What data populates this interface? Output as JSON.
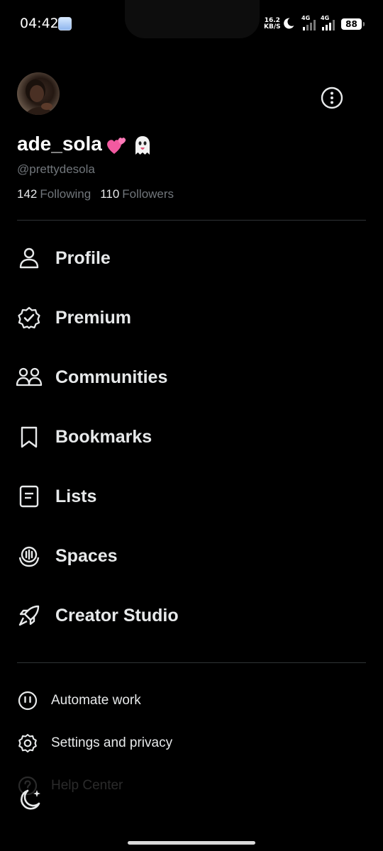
{
  "status_bar": {
    "time": "04:42",
    "net_speed_value": "16.2",
    "net_speed_unit": "KB/S",
    "signal_1": "4G",
    "signal_2": "4G",
    "battery": "88"
  },
  "account": {
    "display_name": "ade_sola",
    "name_emojis": [
      "two-hearts",
      "ghost"
    ],
    "handle": "@prettydesola",
    "following_count": "142",
    "following_label": "Following",
    "followers_count": "110",
    "followers_label": "Followers"
  },
  "menu": {
    "items": [
      {
        "label": "Profile",
        "icon": "person-icon"
      },
      {
        "label": "Premium",
        "icon": "verified-badge-icon"
      },
      {
        "label": "Communities",
        "icon": "people-icon"
      },
      {
        "label": "Bookmarks",
        "icon": "bookmark-icon"
      },
      {
        "label": "Lists",
        "icon": "list-icon"
      },
      {
        "label": "Spaces",
        "icon": "spaces-icon"
      },
      {
        "label": "Creator Studio",
        "icon": "rocket-icon"
      }
    ]
  },
  "secondary": {
    "items": [
      {
        "label": "Automate work",
        "icon": "automate-icon"
      },
      {
        "label": "Settings and privacy",
        "icon": "gear-icon"
      },
      {
        "label": "Help Center",
        "icon": "help-icon"
      }
    ]
  },
  "colors": {
    "background": "#000000",
    "text": "#e7e9ea",
    "muted": "#71767b",
    "divider": "#2f3336"
  }
}
